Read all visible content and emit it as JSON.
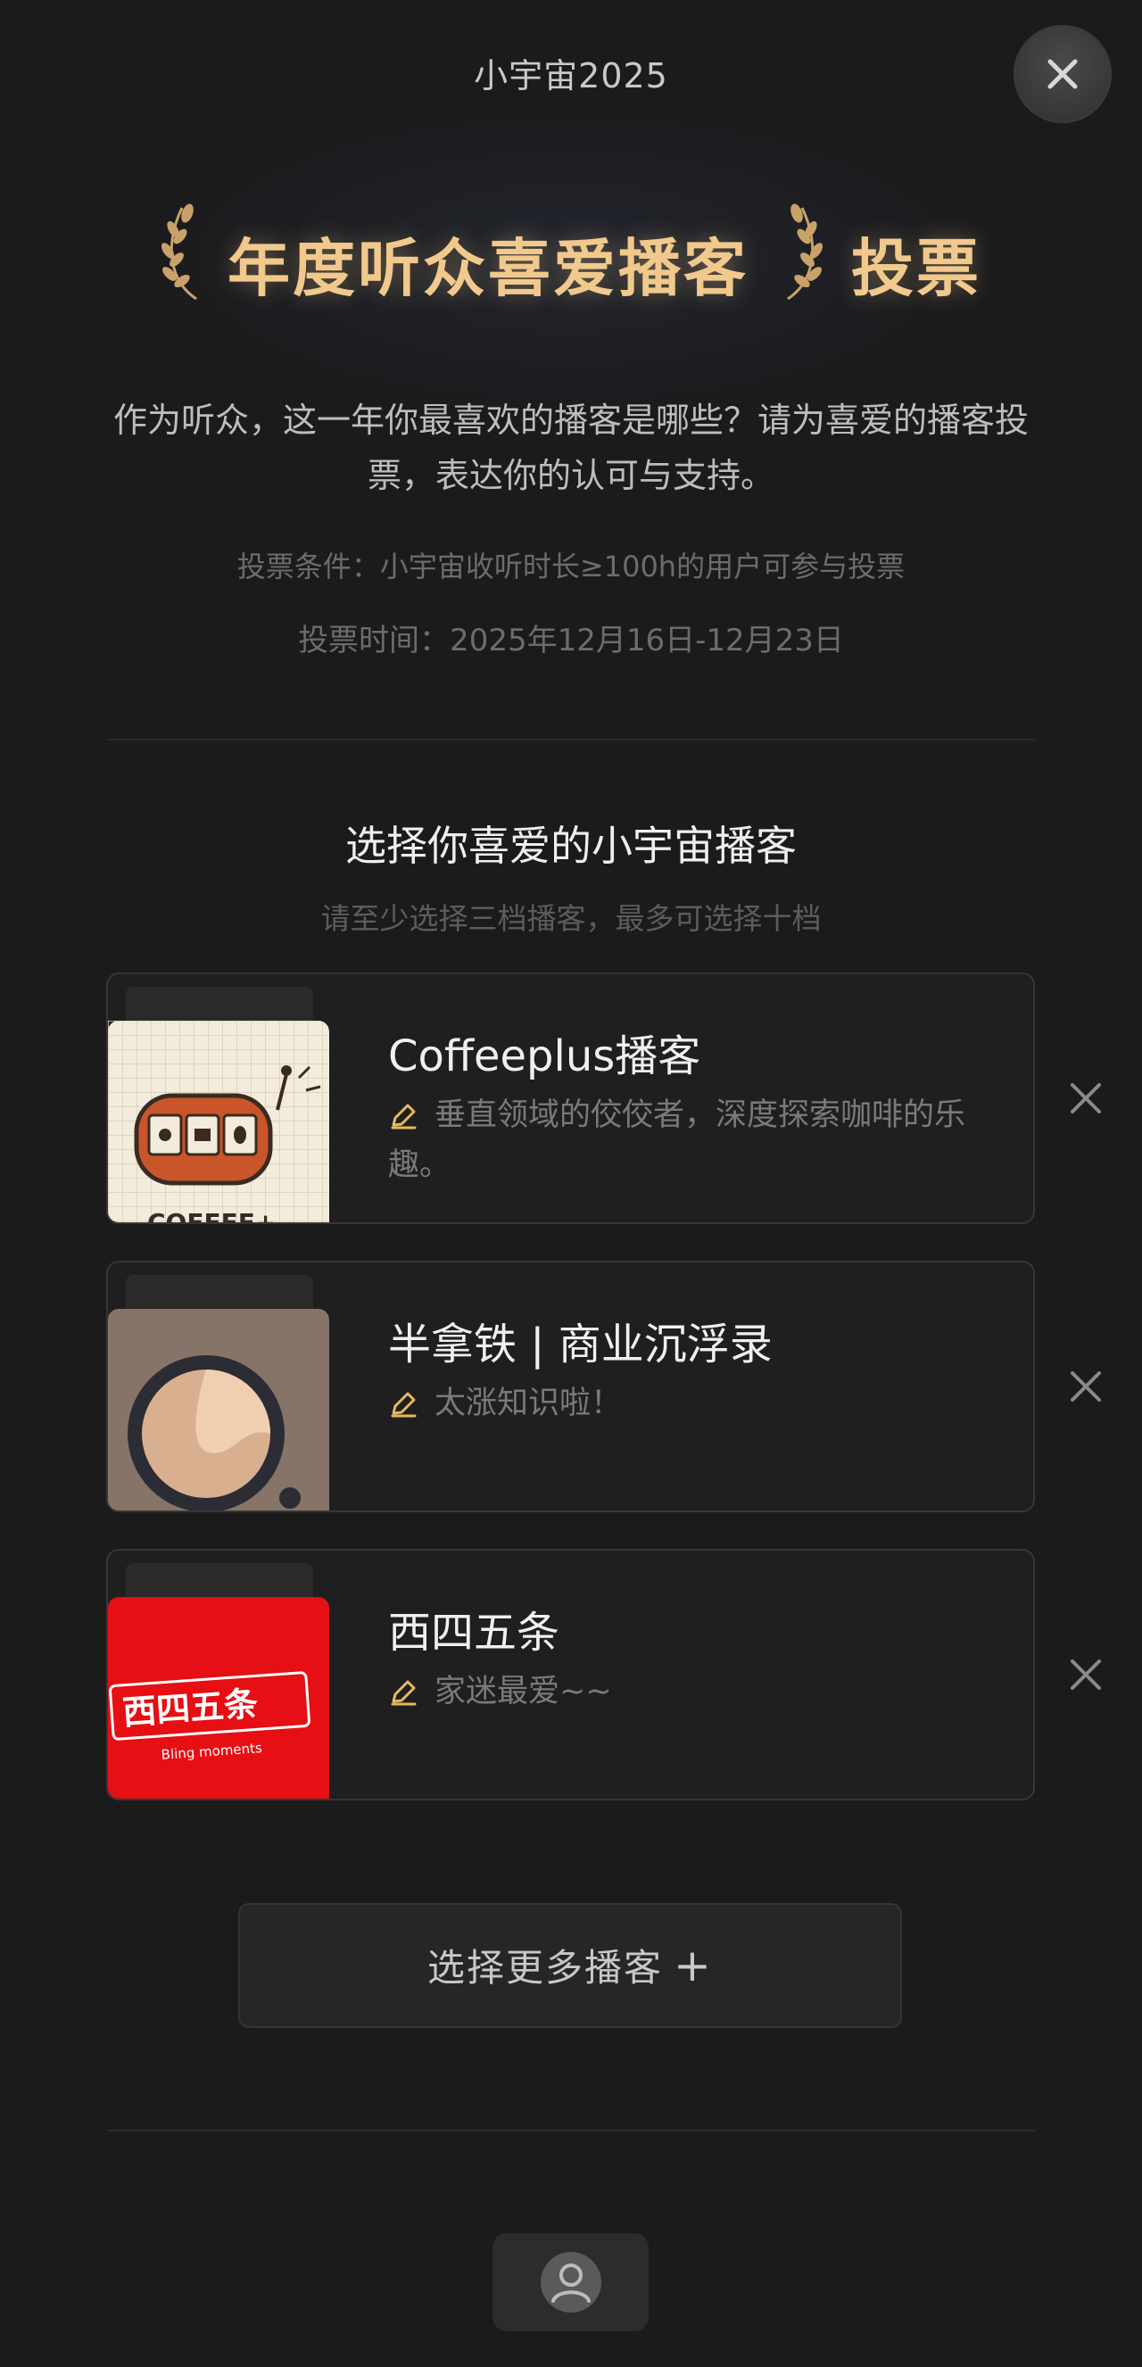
{
  "header": {
    "title": "小宇宙2025",
    "close_icon": "close-icon"
  },
  "hero": {
    "title": "年度听众喜爱播客",
    "vote": "投票",
    "laurel_icon": "laurel-icon"
  },
  "intro": {
    "description": "作为听众，这一年你最喜欢的播客是哪些？请为喜爱的播客投票，表达你的认可与支持。",
    "condition": "投票条件：小宇宙收听时长≥100h的用户可参与投票",
    "time": "投票时间：2025年12月16日-12月23日"
  },
  "selection": {
    "title": "选择你喜爱的小宇宙播客",
    "subtitle": "请至少选择三档播客，最多可选择十档",
    "podcasts": [
      {
        "name": "Coffeeplus播客",
        "note": "垂直领域的佼佼者，深度探索咖啡的乐趣。",
        "cover_text": "COFFEE+"
      },
      {
        "name": "半拿铁 | 商业沉浮录",
        "note": "太涨知识啦！"
      },
      {
        "name": "西四五条",
        "note": "家迷最爱~~",
        "cover_text": "西四五条",
        "cover_subtext": "Bling moments"
      }
    ],
    "more_button": "选择更多播客",
    "more_button_icon": "plus-icon"
  },
  "footer": {
    "avatar_icon": "user-avatar-icon"
  },
  "colors": {
    "background": "#1b1b1c",
    "accent_gold": "#f1c98c",
    "pencil": "#e7b95d"
  }
}
